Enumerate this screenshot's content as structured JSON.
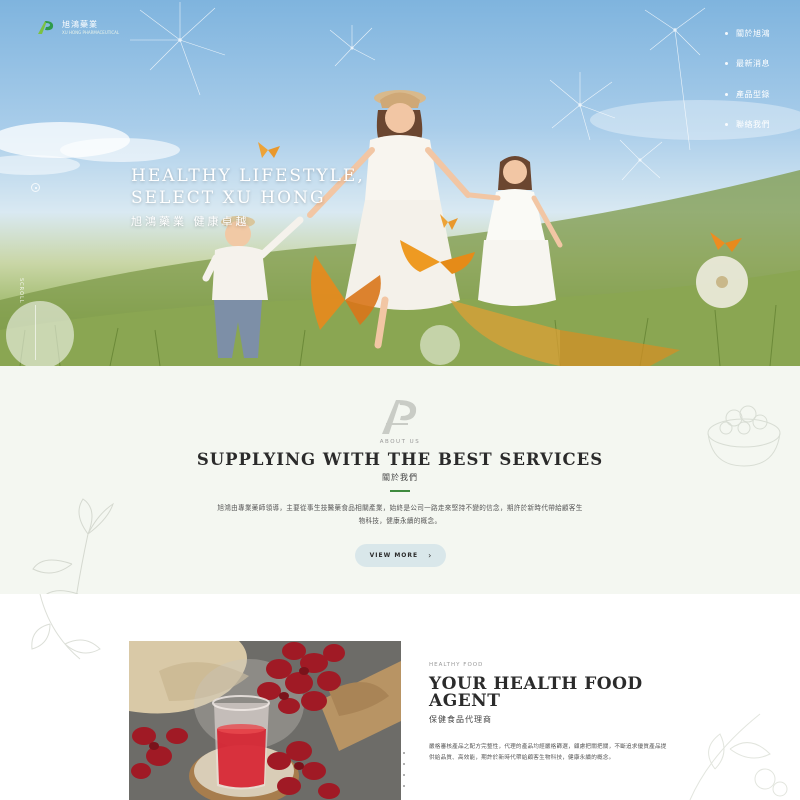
{
  "header": {
    "logo_cn": "旭鴻藥業",
    "logo_en": "XU HONG PHARMACEUTICAL"
  },
  "nav": {
    "items": [
      {
        "label": "關於旭鴻"
      },
      {
        "label": "最新消息"
      },
      {
        "label": "產品型錄"
      },
      {
        "label": "聯絡我們"
      }
    ]
  },
  "hero": {
    "line1": "HEALTHY LIFESTYLE,",
    "line2": "SELECT XU HONG",
    "subtitle": "旭鴻藥業 健康卓越",
    "scroll_label": "SCROLL"
  },
  "about": {
    "eyebrow": "ABOUT US",
    "title": "SUPPLYING WITH THE BEST SERVICES",
    "title_cn": "關於我們",
    "description": "旭鴻由專業藥師領導，主要從事生技醫藥食品相關產業，始終是公司一路走來堅持不變的信念，期許於新時代帶給顧客生物科技，健康永續的概念。",
    "button_label": "VIEW MORE",
    "button_arrow": "›"
  },
  "product": {
    "eyebrow": "HEALTHY FOOD",
    "title_line1": "YOUR HEALTH FOOD",
    "title_line2": "AGENT",
    "title_cn": "保健食品代理商",
    "description": "嚴格審核產品之配方完整性，代理的產品均經嚴格篩選，顧慮把關把關，不斷追求優質產品提供給品質、高效能，期許於新時代帶給顧客生物科技，健康永續的概念。"
  },
  "colors": {
    "accent_green": "#3e8a3e",
    "button_bg": "#d9e7ea",
    "about_bg": "#f4f7f1"
  },
  "icons": {
    "logo": "xuhong-logo-icon",
    "nav_bullet": "dot-icon",
    "arrow": "chevron-right-icon"
  }
}
